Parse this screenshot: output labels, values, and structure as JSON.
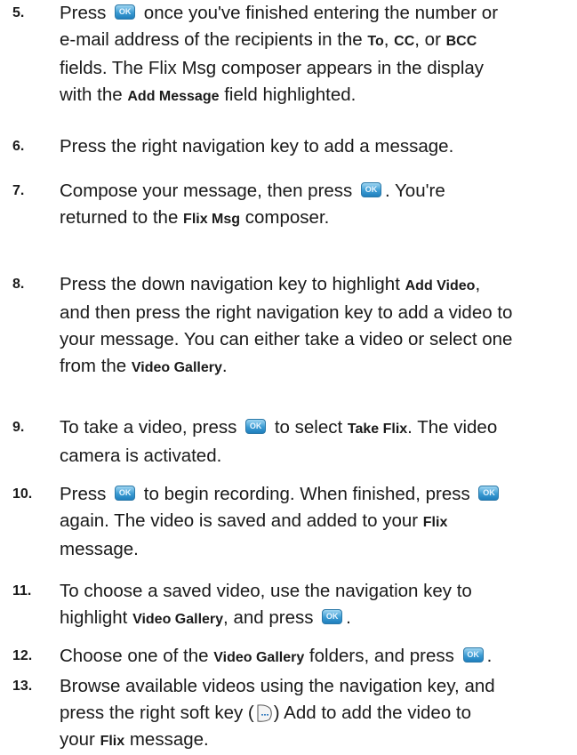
{
  "steps": [
    {
      "number": "5.",
      "lines": [
        [
          "Press ",
          "#ok",
          " once you've finished entering the number or"
        ],
        [
          "e-mail address of the recipients in the ",
          "*To",
          ", ",
          "*CC",
          ", or ",
          "*BCC"
        ],
        [
          "fields. The Flix Msg composer appears in the display"
        ],
        [
          "with the ",
          "*Add Message",
          " field highlighted."
        ]
      ]
    },
    {
      "number": "6.",
      "lines": [
        [
          "Press the right navigation key to add a message."
        ]
      ]
    },
    {
      "number": "7.",
      "lines": [
        [
          "Compose your message, then press ",
          "#ok",
          ". You're"
        ],
        [
          "returned to the ",
          "*Flix Msg",
          " composer."
        ]
      ]
    },
    {
      "number": "8.",
      "lines": [
        [
          "Press the down navigation key to highlight ",
          "*Add Video",
          ","
        ],
        [
          "and then press the right navigation key to add a video to"
        ],
        [
          "your message. You can either take a video or select one"
        ],
        [
          "from the ",
          "*Video Gallery",
          "."
        ]
      ]
    },
    {
      "number": "9.",
      "lines": [
        [
          "To take a video, press ",
          "#ok",
          " to select ",
          "*Take Flix",
          ". The video"
        ],
        [
          "camera is activated."
        ]
      ]
    },
    {
      "number": "10.",
      "lines": [
        [
          "Press ",
          "#ok",
          " to begin recording. When finished, press ",
          "#ok"
        ],
        [
          "again. The video is saved and added to your ",
          "*Flix"
        ],
        [
          "message."
        ]
      ]
    },
    {
      "number": "11.",
      "lines": [
        [
          "To choose a saved video, use the navigation key to"
        ],
        [
          "highlight ",
          "*Video Gallery",
          ", and press ",
          "#ok",
          "."
        ]
      ]
    },
    {
      "number": "12.",
      "lines": [
        [
          "Choose one of the ",
          "*Video Gallery",
          " folders, and press ",
          "#ok",
          "."
        ]
      ]
    },
    {
      "number": "13.",
      "lines": [
        [
          "Browse available videos using the navigation key, and"
        ],
        [
          "press the right soft key (",
          "#soft",
          ") Add to add the video to"
        ],
        [
          "your ",
          "*Flix",
          " message."
        ]
      ]
    }
  ],
  "icons": {
    "ok": "ok-key-icon",
    "soft": "right-soft-key-icon"
  }
}
